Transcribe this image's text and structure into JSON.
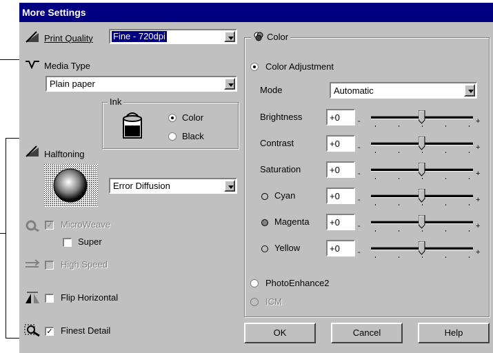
{
  "dialog": {
    "title": "More Settings"
  },
  "left": {
    "print_quality": {
      "label": "Print Quality",
      "value": "Fine - 720dpi"
    },
    "media_type": {
      "label": "Media Type",
      "value": "Plain paper"
    },
    "ink": {
      "group_label": "Ink",
      "color_label": "Color",
      "black_label": "Black",
      "selected": "Color"
    },
    "halftoning": {
      "label": "Halftoning",
      "value": "Error Diffusion"
    },
    "microweave": {
      "label": "MicroWeave",
      "checked": true,
      "enabled": false
    },
    "super": {
      "label": "Super",
      "checked": false
    },
    "high_speed": {
      "label": "High Speed",
      "checked": false,
      "enabled": false
    },
    "flip_horizontal": {
      "label": "Flip Horizontal",
      "checked": false
    },
    "finest_detail": {
      "label": "Finest Detail",
      "checked": true
    }
  },
  "color": {
    "group_label": "Color",
    "color_adjustment": "Color Adjustment",
    "mode": {
      "label": "Mode",
      "value": "Automatic"
    },
    "sliders": [
      {
        "label": "Brightness",
        "value": "+0",
        "level": 0
      },
      {
        "label": "Contrast",
        "value": "+0",
        "level": 0
      },
      {
        "label": "Saturation",
        "value": "+0",
        "level": 0
      },
      {
        "label": "Cyan",
        "value": "+0",
        "level": 0
      },
      {
        "label": "Magenta",
        "value": "+0",
        "level": 0
      },
      {
        "label": "Yellow",
        "value": "+0",
        "level": 0
      }
    ],
    "minus": "-",
    "plus": "+",
    "photoenhance": "PhotoEnhance2",
    "icm": "ICM",
    "dot_colors": {
      "cyan": "#c0c0c0",
      "magenta": "#808080",
      "yellow": "#c0c0c0"
    }
  },
  "buttons": {
    "ok": "OK",
    "cancel": "Cancel",
    "help": "Help"
  }
}
